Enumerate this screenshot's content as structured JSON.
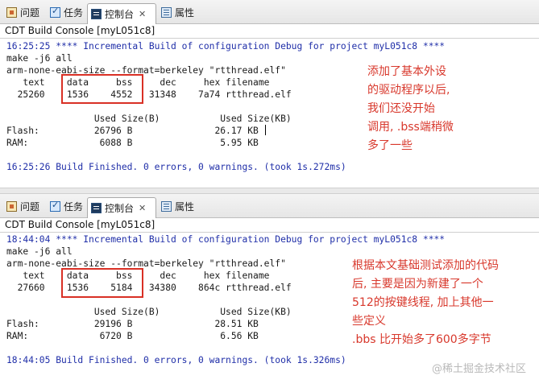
{
  "tabs": [
    {
      "label": "问题",
      "icon": "problems-icon"
    },
    {
      "label": "任务",
      "icon": "tasks-icon"
    },
    {
      "label": "控制台",
      "icon": "console-icon",
      "close": "✕"
    },
    {
      "label": "属性",
      "icon": "properties-icon"
    }
  ],
  "console_title": "CDT Build Console [myL051c8]",
  "panel1": {
    "lines": [
      "16:25:25 **** Incremental Build of configuration Debug for project myL051c8 ****",
      "make -j6 all",
      "arm-none-eabi-size --format=berkeley \"rtthread.elf\"",
      "   text    data     bss     dec     hex filename",
      "  25260    1536    4552   31348    7a74 rtthread.elf",
      "",
      "                Used Size(B)           Used Size(KB)",
      "Flash:          26796 B               26.17 KB",
      "RAM:             6088 B                5.95 KB",
      "",
      "16:25:26 Build Finished. 0 errors, 0 warnings. (took 1s.272ms)"
    ],
    "note": "添加了基本外设\n的驱动程序以后,\n我们还没开始\n调用, .bss端稍微\n多了一些"
  },
  "panel2": {
    "lines": [
      "18:44:04 **** Incremental Build of configuration Debug for project myL051c8 ****",
      "make -j6 all",
      "arm-none-eabi-size --format=berkeley \"rtthread.elf\"",
      "   text    data     bss     dec     hex filename",
      "  27660    1536    5184   34380    864c rtthread.elf",
      "",
      "                Used Size(B)           Used Size(KB)",
      "Flash:          29196 B               28.51 KB",
      "RAM:             6720 B                6.56 KB",
      "",
      "18:44:05 Build Finished. 0 errors, 0 warnings. (took 1s.326ms)"
    ],
    "note": "根据本文基础测试添加的代码\n后, 主要是因为新建了一个\n512的按键线程, 加上其他一\n些定义\n.bbs 比开始多了600多字节"
  },
  "watermark": "@稀土掘金技术社区",
  "colors": {
    "highlight_box": "#d93025",
    "note_text": "#d8382c",
    "build_line": "#1f2ea8"
  }
}
